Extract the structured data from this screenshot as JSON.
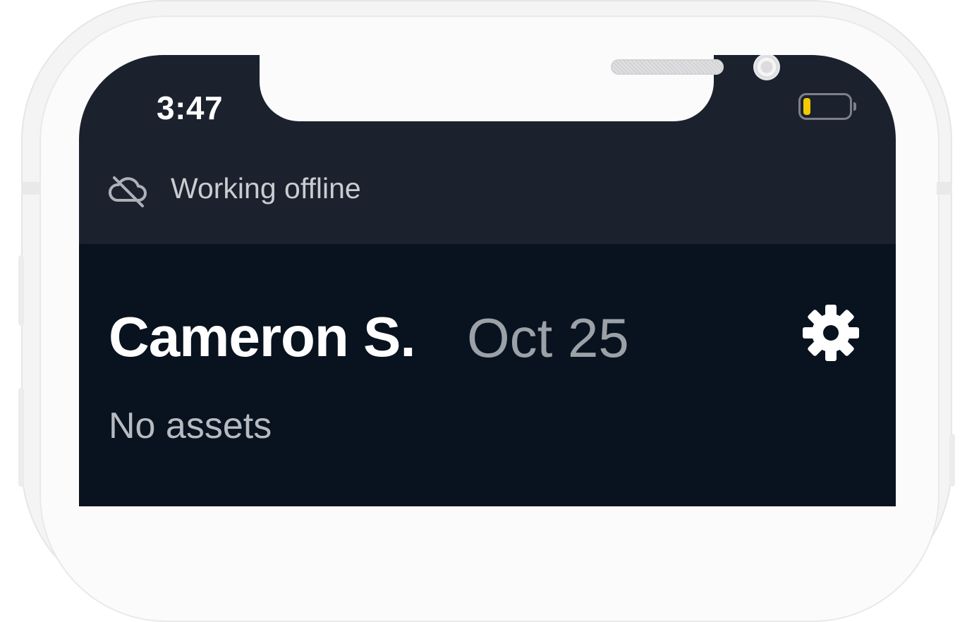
{
  "status_bar": {
    "time": "3:47",
    "battery_icon": "battery-low-icon",
    "battery_level_fraction": 0.15,
    "battery_fill_color": "#f5c800"
  },
  "offline_banner": {
    "icon": "cloud-offline-icon",
    "text": "Working offline"
  },
  "header": {
    "name": "Cameron S.",
    "date": "Oct 25",
    "settings_icon": "gear-icon"
  },
  "assets": {
    "status": "No assets"
  },
  "colors": {
    "screen_top": "#1b222e",
    "content_bg": "#09131f",
    "primary_text": "#ffffff",
    "secondary_text": "#9ca1a8",
    "battery_accent": "#f5c800"
  }
}
